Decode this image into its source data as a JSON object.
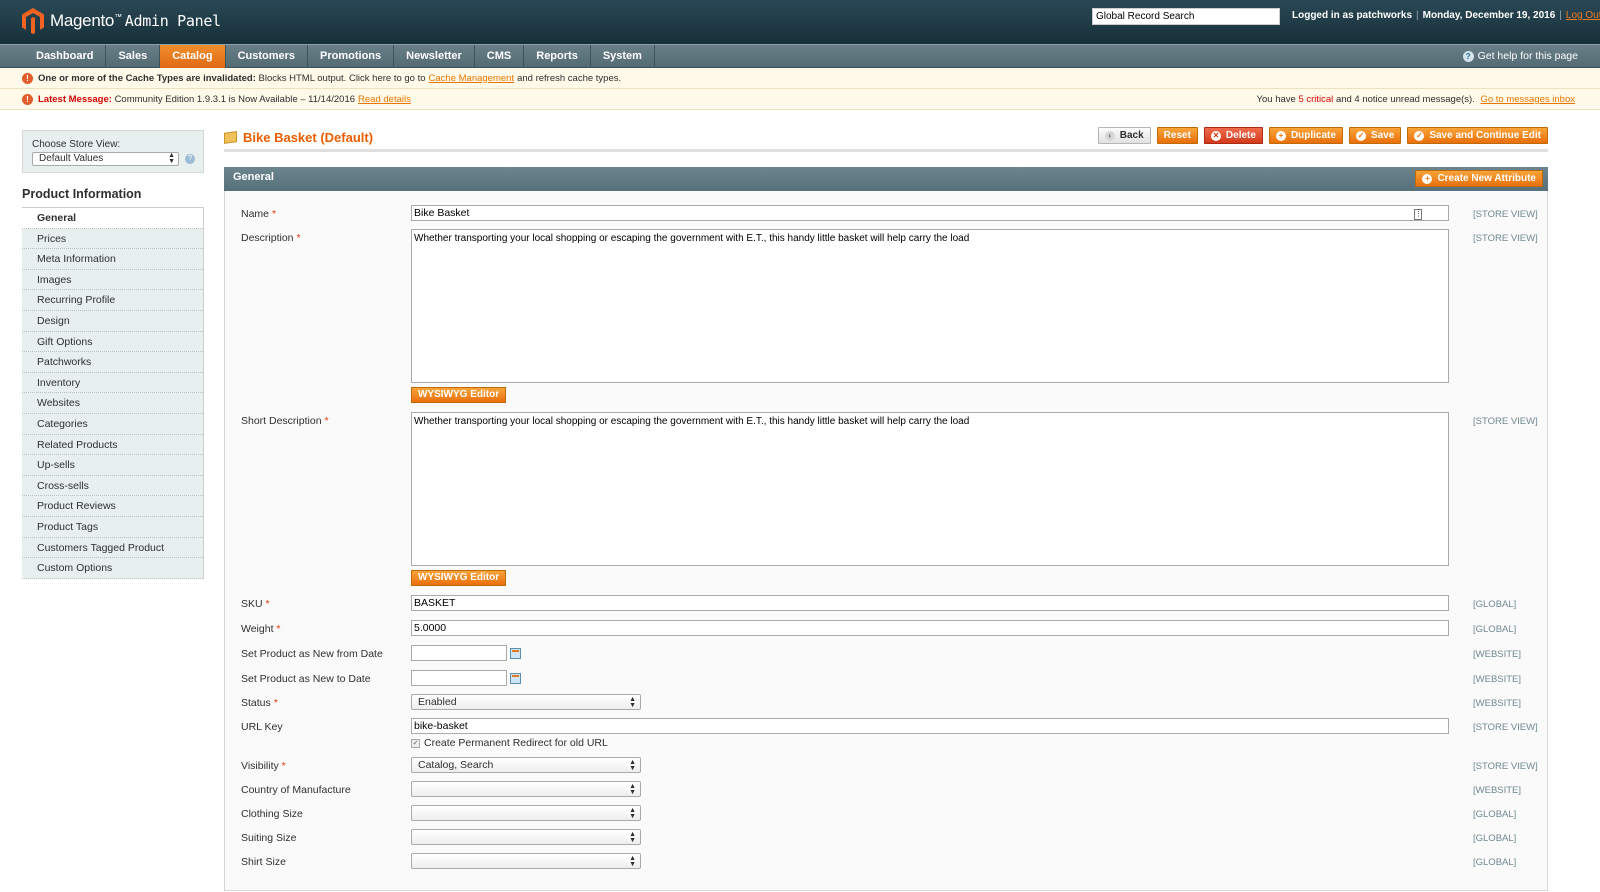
{
  "header": {
    "brand": "Magento",
    "brand_sub": "Admin Panel",
    "search_value": "Global Record Search",
    "logged_in": "Logged in as patchworks",
    "date": "Monday, December 19, 2016",
    "logout": "Log Out"
  },
  "nav": {
    "items": [
      "Dashboard",
      "Sales",
      "Catalog",
      "Customers",
      "Promotions",
      "Newsletter",
      "CMS",
      "Reports",
      "System"
    ],
    "active": "Catalog",
    "help": "Get help for this page"
  },
  "notices": {
    "cache_bold": "One or more of the Cache Types are invalidated:",
    "cache_text": "Blocks HTML output. Click here to go to",
    "cache_link": "Cache Management",
    "cache_tail": "and refresh cache types.",
    "latest_bold": "Latest Message:",
    "latest_text": "Community Edition 1.9.3.1 is Now Available – 11/14/2016",
    "latest_link": "Read details",
    "inbox_pre": "You have",
    "inbox_critical": "5 critical",
    "inbox_mid": "and 4 notice unread message(s).",
    "inbox_link": "Go to messages inbox"
  },
  "sidebar": {
    "store_label": "Choose Store View:",
    "store_value": "Default Values",
    "title": "Product Information",
    "tabs": [
      "General",
      "Prices",
      "Meta Information",
      "Images",
      "Recurring Profile",
      "Design",
      "Gift Options",
      "Patchworks",
      "Inventory",
      "Websites",
      "Categories",
      "Related Products",
      "Up-sells",
      "Cross-sells",
      "Product Reviews",
      "Product Tags",
      "Customers Tagged Product",
      "Custom Options"
    ]
  },
  "page": {
    "title": "Bike Basket (Default)",
    "buttons": {
      "back": "Back",
      "reset": "Reset",
      "delete": "Delete",
      "duplicate": "Duplicate",
      "save": "Save",
      "save_continue": "Save and Continue Edit"
    },
    "fieldset_title": "General",
    "create_attr": "Create New Attribute"
  },
  "form": {
    "name": {
      "label": "Name",
      "value": "Bike Basket",
      "scope": "[STORE VIEW]"
    },
    "description": {
      "label": "Description",
      "value": "Whether transporting your local shopping or escaping the government with E.T., this handy little basket will help carry the load",
      "scope": "[STORE VIEW]"
    },
    "short_description": {
      "label": "Short Description",
      "value": "Whether transporting your local shopping or escaping the government with E.T., this handy little basket will help carry the load",
      "scope": "[STORE VIEW]"
    },
    "wysiwyg": "WYSIWYG Editor",
    "sku": {
      "label": "SKU",
      "value": "BASKET",
      "scope": "[GLOBAL]"
    },
    "weight": {
      "label": "Weight",
      "value": "5.0000",
      "scope": "[GLOBAL]"
    },
    "new_from": {
      "label": "Set Product as New from Date",
      "value": "",
      "scope": "[WEBSITE]"
    },
    "new_to": {
      "label": "Set Product as New to Date",
      "value": "",
      "scope": "[WEBSITE]"
    },
    "status": {
      "label": "Status",
      "value": "Enabled",
      "scope": "[WEBSITE]"
    },
    "url_key": {
      "label": "URL Key",
      "value": "bike-basket",
      "scope": "[STORE VIEW]",
      "redirect": "Create Permanent Redirect for old URL"
    },
    "visibility": {
      "label": "Visibility",
      "value": "Catalog, Search",
      "scope": "[STORE VIEW]"
    },
    "country": {
      "label": "Country of Manufacture",
      "value": "",
      "scope": "[WEBSITE]"
    },
    "clothing_size": {
      "label": "Clothing Size",
      "value": "",
      "scope": "[GLOBAL]"
    },
    "suiting_size": {
      "label": "Suiting Size",
      "value": "",
      "scope": "[GLOBAL]"
    },
    "shirt_size": {
      "label": "Shirt Size",
      "value": "",
      "scope": "[GLOBAL]"
    }
  }
}
